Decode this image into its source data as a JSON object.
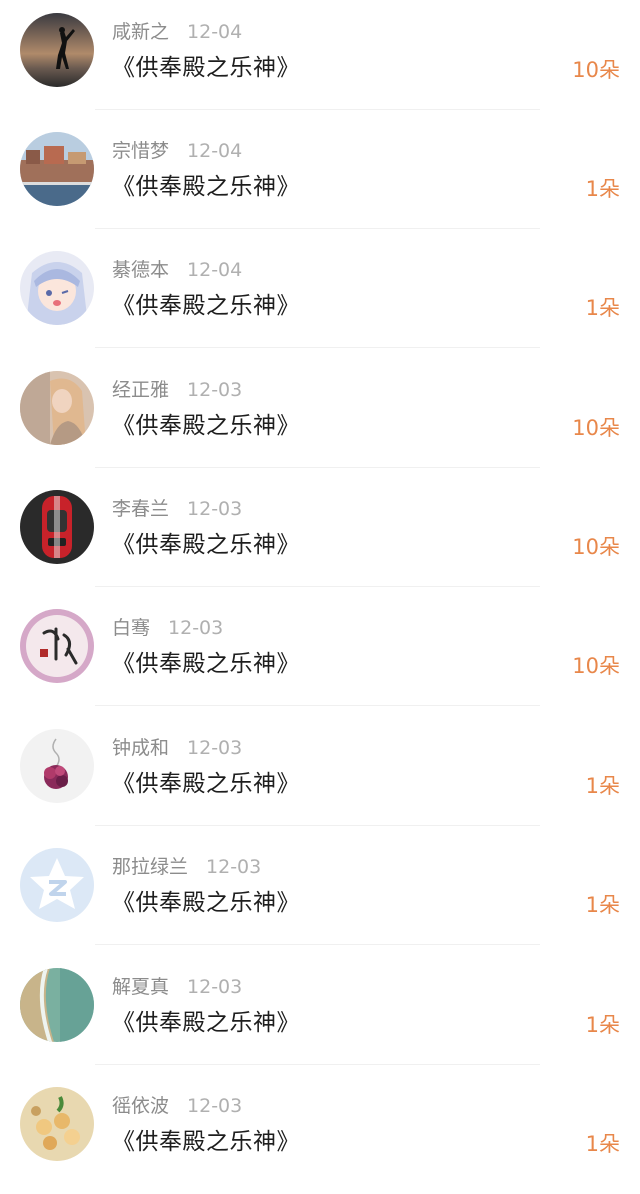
{
  "colors": {
    "gift_text": "#e8874a",
    "name_text": "#8c8c8c",
    "date_text": "#b0b0b0",
    "title_text": "#1e1e1e",
    "divider": "#f0f0f0"
  },
  "items": [
    {
      "name": "咸新之",
      "date": "12-04",
      "title": "《供奉殿之乐神》",
      "gift": "10朵",
      "avatar_icon": "silhouette-sunset-avatar-icon"
    },
    {
      "name": "宗惜梦",
      "date": "12-04",
      "title": "《供奉殿之乐神》",
      "gift": "1朵",
      "avatar_icon": "city-harbor-avatar-icon"
    },
    {
      "name": "綦德本",
      "date": "12-04",
      "title": "《供奉殿之乐神》",
      "gift": "1朵",
      "avatar_icon": "anime-girl-avatar-icon"
    },
    {
      "name": "经正雅",
      "date": "12-03",
      "title": "《供奉殿之乐神》",
      "gift": "10朵",
      "avatar_icon": "blonde-woman-avatar-icon"
    },
    {
      "name": "李春兰",
      "date": "12-03",
      "title": "《供奉殿之乐神》",
      "gift": "10朵",
      "avatar_icon": "red-car-avatar-icon"
    },
    {
      "name": "白骞",
      "date": "12-03",
      "title": "《供奉殿之乐神》",
      "gift": "10朵",
      "avatar_icon": "mid-autumn-calligraphy-avatar-icon"
    },
    {
      "name": "钟成和",
      "date": "12-03",
      "title": "《供奉殿之乐神》",
      "gift": "1朵",
      "avatar_icon": "purple-flower-avatar-icon"
    },
    {
      "name": "那拉绿兰",
      "date": "12-03",
      "title": "《供奉殿之乐神》",
      "gift": "1朵",
      "avatar_icon": "default-qzone-star-avatar-icon"
    },
    {
      "name": "解夏真",
      "date": "12-03",
      "title": "《供奉殿之乐神》",
      "gift": "1朵",
      "avatar_icon": "beach-shore-avatar-icon"
    },
    {
      "name": "徭依波",
      "date": "12-03",
      "title": "《供奉殿之乐神》",
      "gift": "1朵",
      "avatar_icon": "food-dish-avatar-icon"
    }
  ]
}
